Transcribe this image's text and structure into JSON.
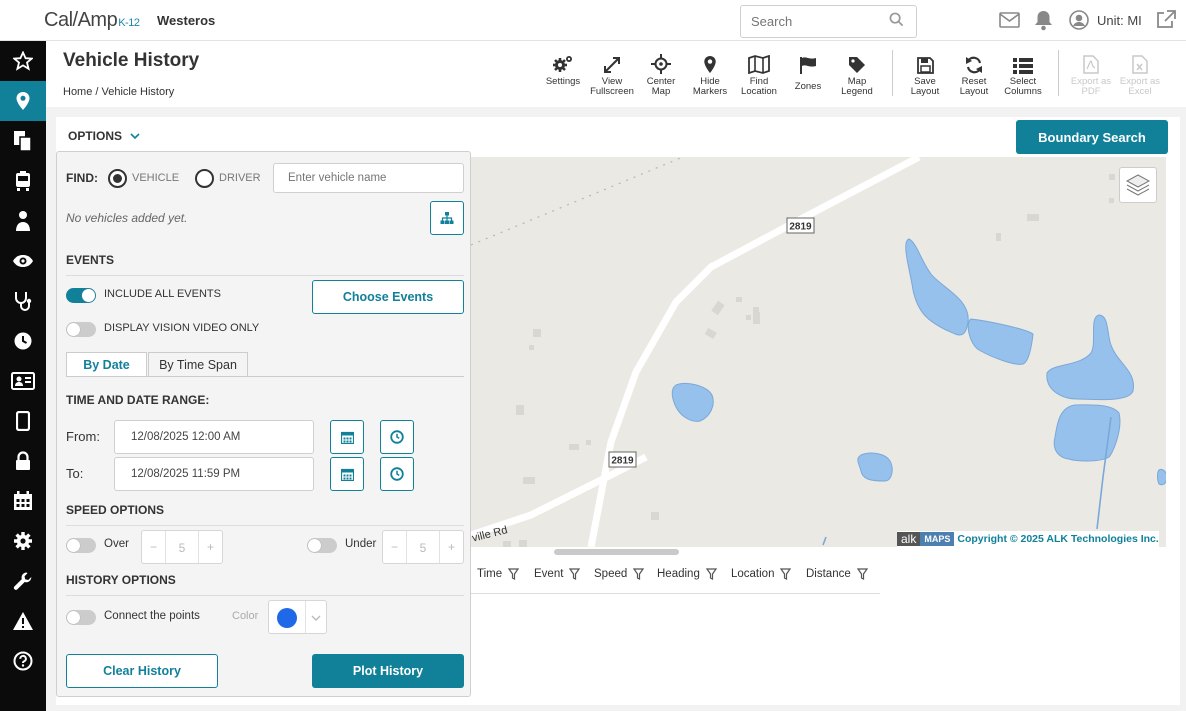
{
  "app": {
    "logo_main": "Cal/Amp",
    "logo_sub": "K-12",
    "org": "Westeros",
    "search_placeholder": "Search",
    "unit": "Unit: MI"
  },
  "page": {
    "title": "Vehicle History",
    "breadcrumb": "Home / Vehicle History"
  },
  "toolbar": [
    {
      "id": "settings",
      "label": "Settings",
      "icon": "gears-icon"
    },
    {
      "id": "view_fullscreen",
      "label": "View Fullscreen",
      "icon": "expand-icon"
    },
    {
      "id": "center_map",
      "label": "Center Map",
      "icon": "crosshair-icon"
    },
    {
      "id": "hide_markers",
      "label": "Hide Markers",
      "icon": "map-marker-icon"
    },
    {
      "id": "find_location",
      "label": "Find Location",
      "icon": "map-icon"
    },
    {
      "id": "zones",
      "label": "Zones",
      "icon": "flag-icon"
    },
    {
      "id": "map_legend",
      "label": "Map Legend",
      "icon": "tag-icon"
    },
    {
      "id": "save_layout",
      "label": "Save Layout",
      "icon": "floppy-icon"
    },
    {
      "id": "reset_layout",
      "label": "Reset Layout",
      "icon": "refresh-icon"
    },
    {
      "id": "select_columns",
      "label": "Select Columns",
      "icon": "list-icon"
    },
    {
      "id": "export_pdf",
      "label": "Export as PDF",
      "icon": "pdf-icon",
      "disabled": true
    },
    {
      "id": "export_excel",
      "label": "Export as Excel",
      "icon": "excel-icon",
      "disabled": true
    }
  ],
  "options_label": "OPTIONS",
  "boundary_search": "Boundary Search",
  "panel": {
    "find_label": "FIND:",
    "vehicle": "VEHICLE",
    "driver": "DRIVER",
    "vehicle_placeholder": "Enter vehicle name",
    "no_vehicles": "No vehicles added yet.",
    "events_heading": "EVENTS",
    "include_all_events": "INCLUDE ALL EVENTS",
    "display_vision": "DISPLAY VISION VIDEO ONLY",
    "choose_events": "Choose Events",
    "tab_by_date": "By Date",
    "tab_by_time_span": "By Time Span",
    "time_range_heading": "TIME AND DATE RANGE:",
    "from_label": "From:",
    "from_value": "12/08/2025 12:00 AM",
    "to_label": "To:",
    "to_value": "12/08/2025 11:59 PM",
    "speed_heading": "SPEED OPTIONS",
    "over_label": "Over",
    "over_value": "5",
    "under_label": "Under",
    "under_value": "5",
    "minus": "−",
    "plus": "+",
    "history_heading": "HISTORY OPTIONS",
    "connect_points": "Connect the points",
    "color_label": "Color",
    "color_value": "#1f68e8",
    "clear_history": "Clear History",
    "plot_history": "Plot History"
  },
  "map": {
    "road_labels": [
      "2819",
      "2819",
      "ville Rd"
    ],
    "alk": "alk",
    "maps": "MAPS",
    "copyright": "Copyright © 2025 ALK Technologies Inc."
  },
  "grid": {
    "columns": [
      "Time",
      "Event",
      "Speed",
      "Heading",
      "Location",
      "Distance"
    ]
  },
  "colors": {
    "accent": "#11819a",
    "sidebar": "#0b0b0b",
    "water": "#95c1ec"
  }
}
